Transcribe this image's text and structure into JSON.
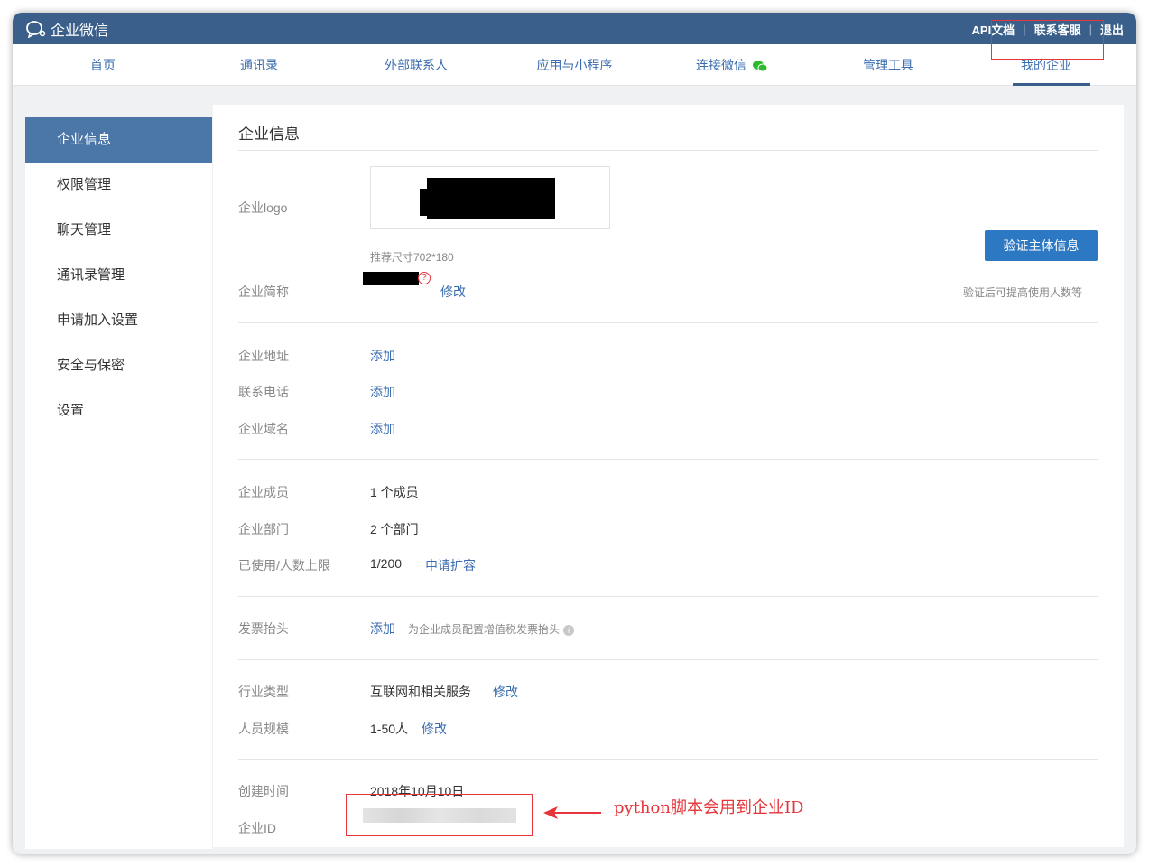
{
  "app": {
    "brand": "企业微信"
  },
  "toplinks": [
    "API文档",
    "联系客服",
    "退出"
  ],
  "nav": [
    "首页",
    "通讯录",
    "外部联系人",
    "应用与小程序",
    "连接微信",
    "管理工具",
    "我的企业"
  ],
  "sidebar": [
    "企业信息",
    "权限管理",
    "聊天管理",
    "通讯录管理",
    "申请加入设置",
    "安全与保密",
    "设置"
  ],
  "main": {
    "title": "企业信息",
    "logo_label": "企业logo",
    "logo_hint": "推荐尺寸702*180",
    "verify_button": "验证主体信息",
    "verify_hint": "验证后可提高使用人数等",
    "short_name_label": "企业简称",
    "edit": "修改",
    "add": "添加",
    "address_label": "企业地址",
    "phone_label": "联系电话",
    "domain_label": "企业域名",
    "members_label": "企业成员",
    "members_value": "1 个成员",
    "depts_label": "企业部门",
    "depts_value": "2 个部门",
    "limit_label": "已使用/人数上限",
    "limit_value": "1/200",
    "expand_link": "申请扩容",
    "invoice_label": "发票抬头",
    "invoice_hint": "为企业成员配置增值税发票抬头",
    "industry_label": "行业类型",
    "industry_value": "互联网和相关服务",
    "scale_label": "人员规模",
    "scale_value": "1-50人",
    "created_label": "创建时间",
    "created_value": "2018年10月10日",
    "id_label": "企业ID"
  },
  "annotation": "python脚本会用到企业ID",
  "colors": {
    "topbar": "#3a5f8a",
    "accent": "#2d78c2",
    "active_side": "#4b76a8",
    "highlight": "#e5343a"
  }
}
